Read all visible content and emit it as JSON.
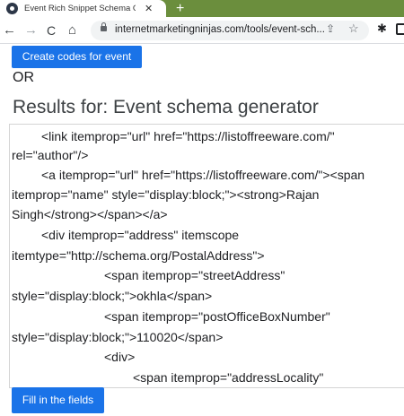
{
  "browser": {
    "tab_title": "Event Rich Snippet Schema Gene",
    "tab_close": "✕",
    "new_tab": "+",
    "url": "internetmarketingninjas.com/tools/event-sch...",
    "back": "←",
    "forward": "→",
    "reload": "C",
    "home": "⌂",
    "share": "⇪",
    "star": "☆",
    "extension": "✱"
  },
  "page": {
    "create_button": "Create codes for event",
    "or_text": "OR",
    "results_title": "Results for: Event schema generator",
    "fill_button": "Fill in the fields"
  },
  "code": {
    "lines": [
      "<link itemprop=\"url\" href=\"https://listoffreeware.com/\"",
      "rel=\"author\"/>",
      "<a itemprop=\"url\" href=\"https://listoffreeware.com/\"><span",
      "itemprop=\"name\" style=\"display:block;\"><strong>Rajan",
      "Singh</strong></span></a>",
      "<div itemprop=\"address\" itemscope",
      "itemtype=\"http://schema.org/PostalAddress\">",
      "<span itemprop=\"streetAddress\"",
      "style=\"display:block;\">okhla</span>",
      "<span itemprop=\"postOfficeBoxNumber\"",
      "style=\"display:block;\">110020</span>",
      "<div>",
      "<span itemprop=\"addressLocality\""
    ]
  },
  "colors": {
    "tab_strip": "#6b8e3d",
    "button_blue": "#1a73e8"
  }
}
